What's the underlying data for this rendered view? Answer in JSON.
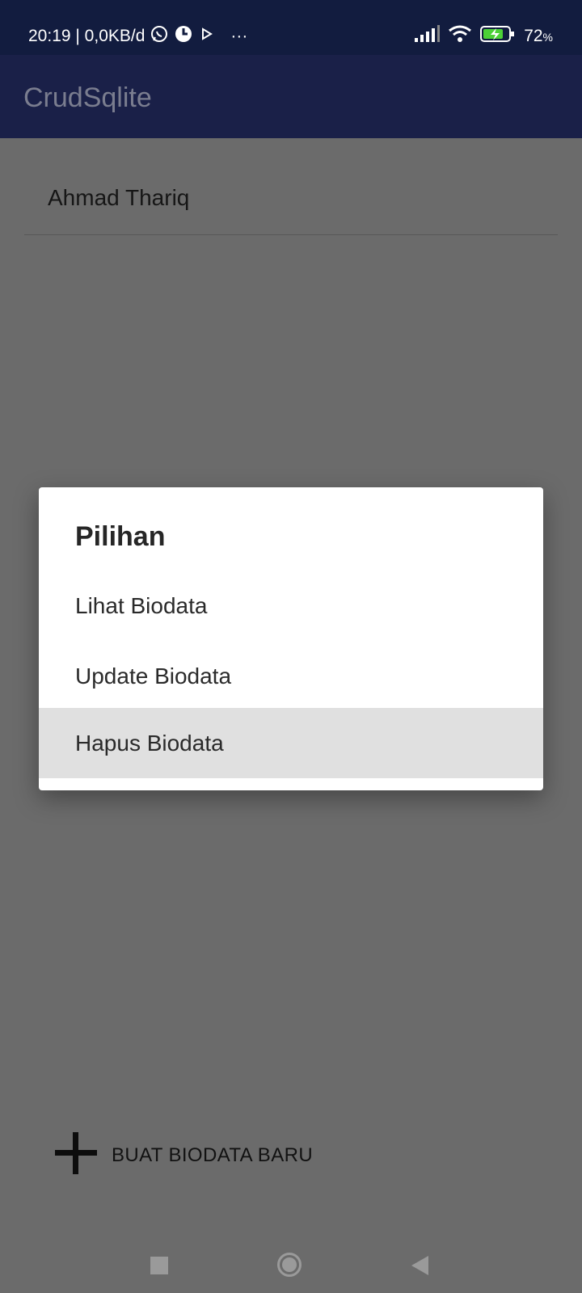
{
  "status_bar": {
    "time_network": "20:19 | 0,0KB/d",
    "more": "···",
    "battery_percent": "72",
    "battery_unit": "%",
    "icons": [
      "whatsapp-icon",
      "circle-app-icon",
      "play-icon",
      "signal-icon",
      "wifi-icon",
      "battery-charging-icon"
    ]
  },
  "app_bar": {
    "title": "CrudSqlite"
  },
  "list": {
    "items": [
      {
        "label": "Ahmad Thariq"
      }
    ]
  },
  "fab": {
    "label": "BUAT BIODATA BARU",
    "icon": "plus-icon"
  },
  "dialog": {
    "title": "Pilihan",
    "options": [
      {
        "label": "Lihat Biodata"
      },
      {
        "label": "Update Biodata"
      },
      {
        "label": "Hapus Biodata",
        "highlighted": true
      }
    ]
  },
  "nav_bar": {
    "icons": [
      "recents-square-icon",
      "home-circle-icon",
      "back-triangle-icon"
    ]
  },
  "colors": {
    "status_bar": "#121c3f",
    "app_bar": "#1a2048",
    "scrim": "#6b6b6b",
    "dialog": "#ffffff",
    "highlight": "#e0e0e0"
  }
}
